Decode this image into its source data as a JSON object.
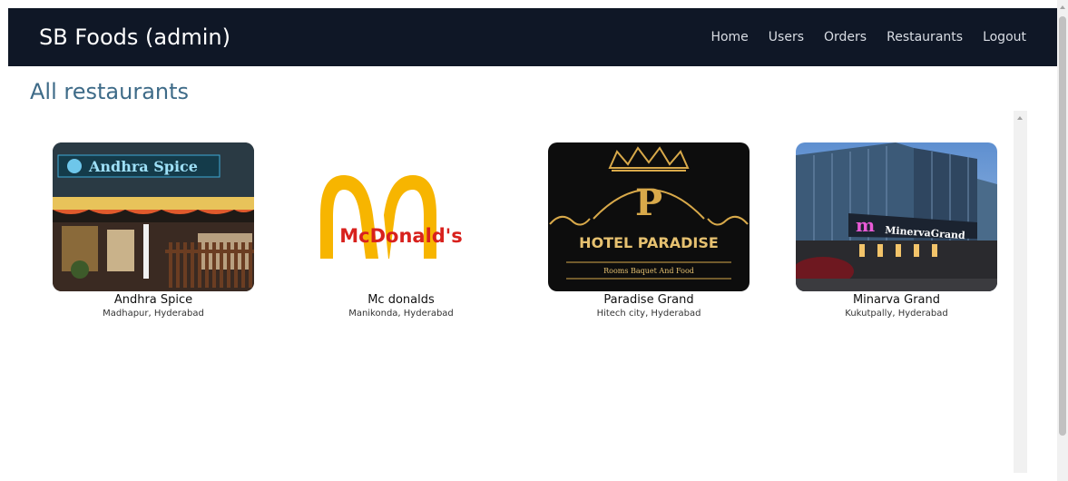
{
  "navbar": {
    "brand": "SB Foods (admin)",
    "links": [
      "Home",
      "Users",
      "Orders",
      "Restaurants",
      "Logout"
    ]
  },
  "page": {
    "title": "All restaurants"
  },
  "restaurants": [
    {
      "name": "Andhra Spice",
      "address": "Madhapur, Hyderabad",
      "logo_text": "Andhra Spice"
    },
    {
      "name": "Mc donalds",
      "address": "Manikonda, Hyderabad",
      "logo_text": "McDonald's"
    },
    {
      "name": "Paradise Grand",
      "address": "Hitech city, Hyderabad",
      "logo_text": "HOTEL PARADISE",
      "logo_letter": "P",
      "logo_subtext": "Rooms Baquet And Food"
    },
    {
      "name": "Minarva Grand",
      "address": "Kukutpally, Hyderabad",
      "logo_text": "MinervaGrand"
    }
  ],
  "colors": {
    "navbar_bg": "#0f1726",
    "title": "#3e6b88",
    "mcd_yellow": "#f7b500",
    "mcd_red": "#d8211d",
    "gold": "#d8a94a"
  }
}
